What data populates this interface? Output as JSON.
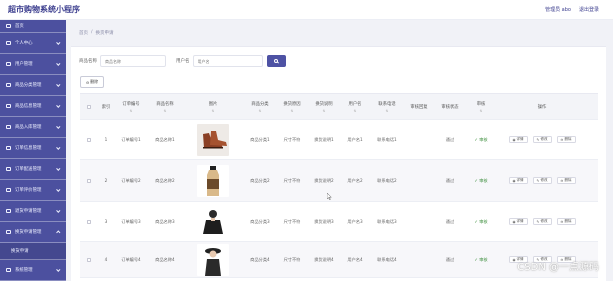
{
  "header": {
    "title": "超市购物系统小程序",
    "admin_label": "管理员 abo",
    "logout_label": "退出登录"
  },
  "sidebar": {
    "items": [
      {
        "label": "首页",
        "icon": "home-icon"
      },
      {
        "label": "个人中心",
        "icon": "user-icon"
      },
      {
        "label": "用户管理",
        "icon": "users-icon"
      },
      {
        "label": "商品分类管理",
        "icon": "category-icon"
      },
      {
        "label": "商品信息管理",
        "icon": "product-icon"
      },
      {
        "label": "商品入库管理",
        "icon": "inbox-icon"
      },
      {
        "label": "订单信息管理",
        "icon": "order-icon"
      },
      {
        "label": "订单配送管理",
        "icon": "delivery-icon"
      },
      {
        "label": "订单评价管理",
        "icon": "review-icon"
      },
      {
        "label": "退货申请管理",
        "icon": "return-icon"
      },
      {
        "label": "换货申请管理",
        "icon": "exchange-icon"
      },
      {
        "label": "换货申请",
        "icon": ""
      },
      {
        "label": "系统管理",
        "icon": "settings-icon"
      }
    ]
  },
  "breadcrumb": [
    "首页",
    "/",
    "换货申请"
  ],
  "search": {
    "label_product": "商品名称",
    "placeholder_product": "商品名称",
    "label_user": "用户名",
    "placeholder_user": "用户名"
  },
  "toolbar": {
    "delete_label": "删除"
  },
  "table": {
    "columns": [
      "索引",
      "订单编号",
      "商品名称",
      "图片",
      "商品分类",
      "换货原因",
      "换货说明",
      "用户名",
      "联系电话",
      "审核回复",
      "审核状态",
      "审核",
      "操作"
    ],
    "sort_mark": "⇅",
    "rows": [
      {
        "index": "1",
        "order_no": "订单编号1",
        "product": "商品名称1",
        "image": "shoes",
        "category": "商品分类1",
        "reason": "尺寸不符",
        "note": "换货说明1",
        "user": "用户名1",
        "phone": "联系电话1",
        "reply": "",
        "status": "通过",
        "review": "审核"
      },
      {
        "index": "2",
        "order_no": "订单编号2",
        "product": "商品名称2",
        "image": "bottle",
        "category": "商品分类2",
        "reason": "尺寸不符",
        "note": "换货说明2",
        "user": "用户名2",
        "phone": "联系电话2",
        "reply": "",
        "status": "通过",
        "review": "审核"
      },
      {
        "index": "3",
        "order_no": "订单编号3",
        "product": "商品名称3",
        "image": "person",
        "category": "商品分类3",
        "reason": "尺寸不符",
        "note": "换货说明3",
        "user": "用户名3",
        "phone": "联系电话3",
        "reply": "",
        "status": "通过",
        "review": "审核"
      },
      {
        "index": "4",
        "order_no": "订单编号4",
        "product": "商品名称4",
        "image": "person-hat",
        "category": "商品分类4",
        "reason": "尺寸不符",
        "note": "换货说明4",
        "user": "用户名4",
        "phone": "联系电话4",
        "reply": "",
        "status": "通过",
        "review": "审核"
      }
    ],
    "ops": {
      "detail": "详情",
      "edit": "修改",
      "delete": "删除"
    }
  },
  "watermark": "CSDN @一点源码",
  "colors": {
    "sidebar": "#4c509f",
    "accent": "#4e52a4",
    "approve_green": "#3a8d3a"
  }
}
